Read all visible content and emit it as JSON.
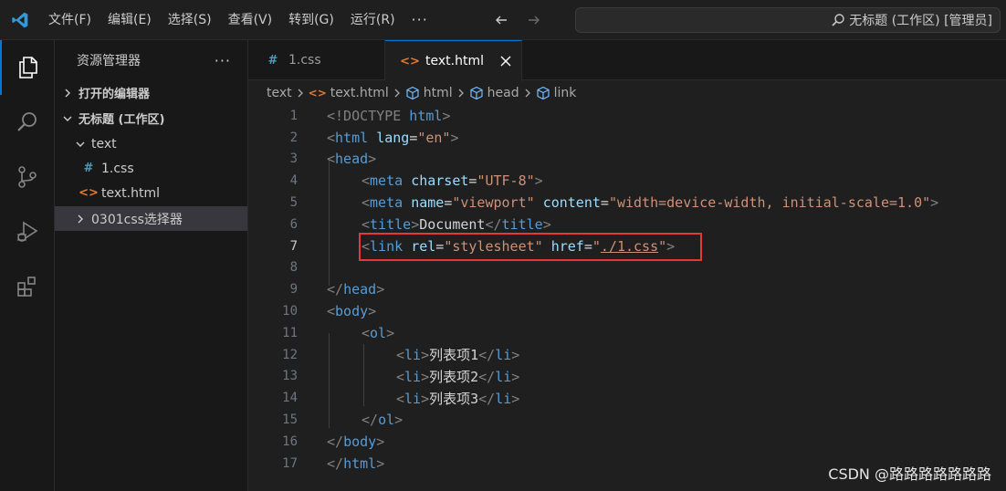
{
  "titlebar": {
    "menu": [
      "文件(F)",
      "编辑(E)",
      "选择(S)",
      "查看(V)",
      "转到(G)",
      "运行(R)",
      "···"
    ],
    "command_center": "无标题 (工作区) [管理员]"
  },
  "activitybar": {
    "items": [
      "explorer-icon",
      "search-icon",
      "source-control-icon",
      "run-debug-icon",
      "extensions-icon"
    ]
  },
  "sidebar": {
    "title": "资源管理器",
    "more": "···",
    "open_editors": "打开的编辑器",
    "workspace": "无标题 (工作区)",
    "folder": "text",
    "files": [
      {
        "icon": "#",
        "name": "1.css"
      },
      {
        "icon": "<>",
        "name": "text.html"
      }
    ],
    "folder2": "0301css选择器"
  },
  "tabs": [
    {
      "icon": "#",
      "label": "1.css"
    },
    {
      "icon": "<>",
      "label": "text.html"
    }
  ],
  "breadcrumb": {
    "root": "text",
    "file": "text.html",
    "items": [
      "html",
      "head",
      "link"
    ]
  },
  "editor": {
    "current_line": 7,
    "line_numbers": [
      "1",
      "2",
      "3",
      "4",
      "5",
      "6",
      "7",
      "8",
      "9",
      "10",
      "11",
      "12",
      "13",
      "14",
      "15",
      "16",
      "17"
    ],
    "lines": {
      "l1_a": "<!DOCTYPE",
      "l1_b": " html",
      "l1_c": ">",
      "l2_tag": "html",
      "l2_attr": "lang",
      "l2_val": "\"en\"",
      "l3_tag": "head",
      "l4_tag": "meta",
      "l4_attr": "charset",
      "l4_val": "\"UTF-8\"",
      "l5_tag": "meta",
      "l5_attr1": "name",
      "l5_val1": "\"viewport\"",
      "l5_attr2": "content",
      "l5_val2": "\"width=device-width, initial-scale=1.0\"",
      "l6_tag": "title",
      "l6_text": "Document",
      "l7_tag": "link",
      "l7_attr1": "rel",
      "l7_val1": "\"stylesheet\"",
      "l7_attr2": "href",
      "l7_q1": "\"",
      "l7_path": "./1.css",
      "l7_q2": "\"",
      "l9_tag": "head",
      "l10_tag": "body",
      "l11_tag": "ol",
      "l12_tag": "li",
      "l12_text": "列表项1",
      "l13_tag": "li",
      "l13_text": "列表项2",
      "l14_tag": "li",
      "l14_text": "列表项3",
      "l15_tag": "ol",
      "l16_tag": "body",
      "l17_tag": "html"
    }
  },
  "watermark": "CSDN @路路路路路路路",
  "colors": {
    "accent": "#0078d4",
    "highlight_box": "#e53935",
    "tag": "#569cd6",
    "attr": "#9cdcfe",
    "string": "#ce9178"
  }
}
